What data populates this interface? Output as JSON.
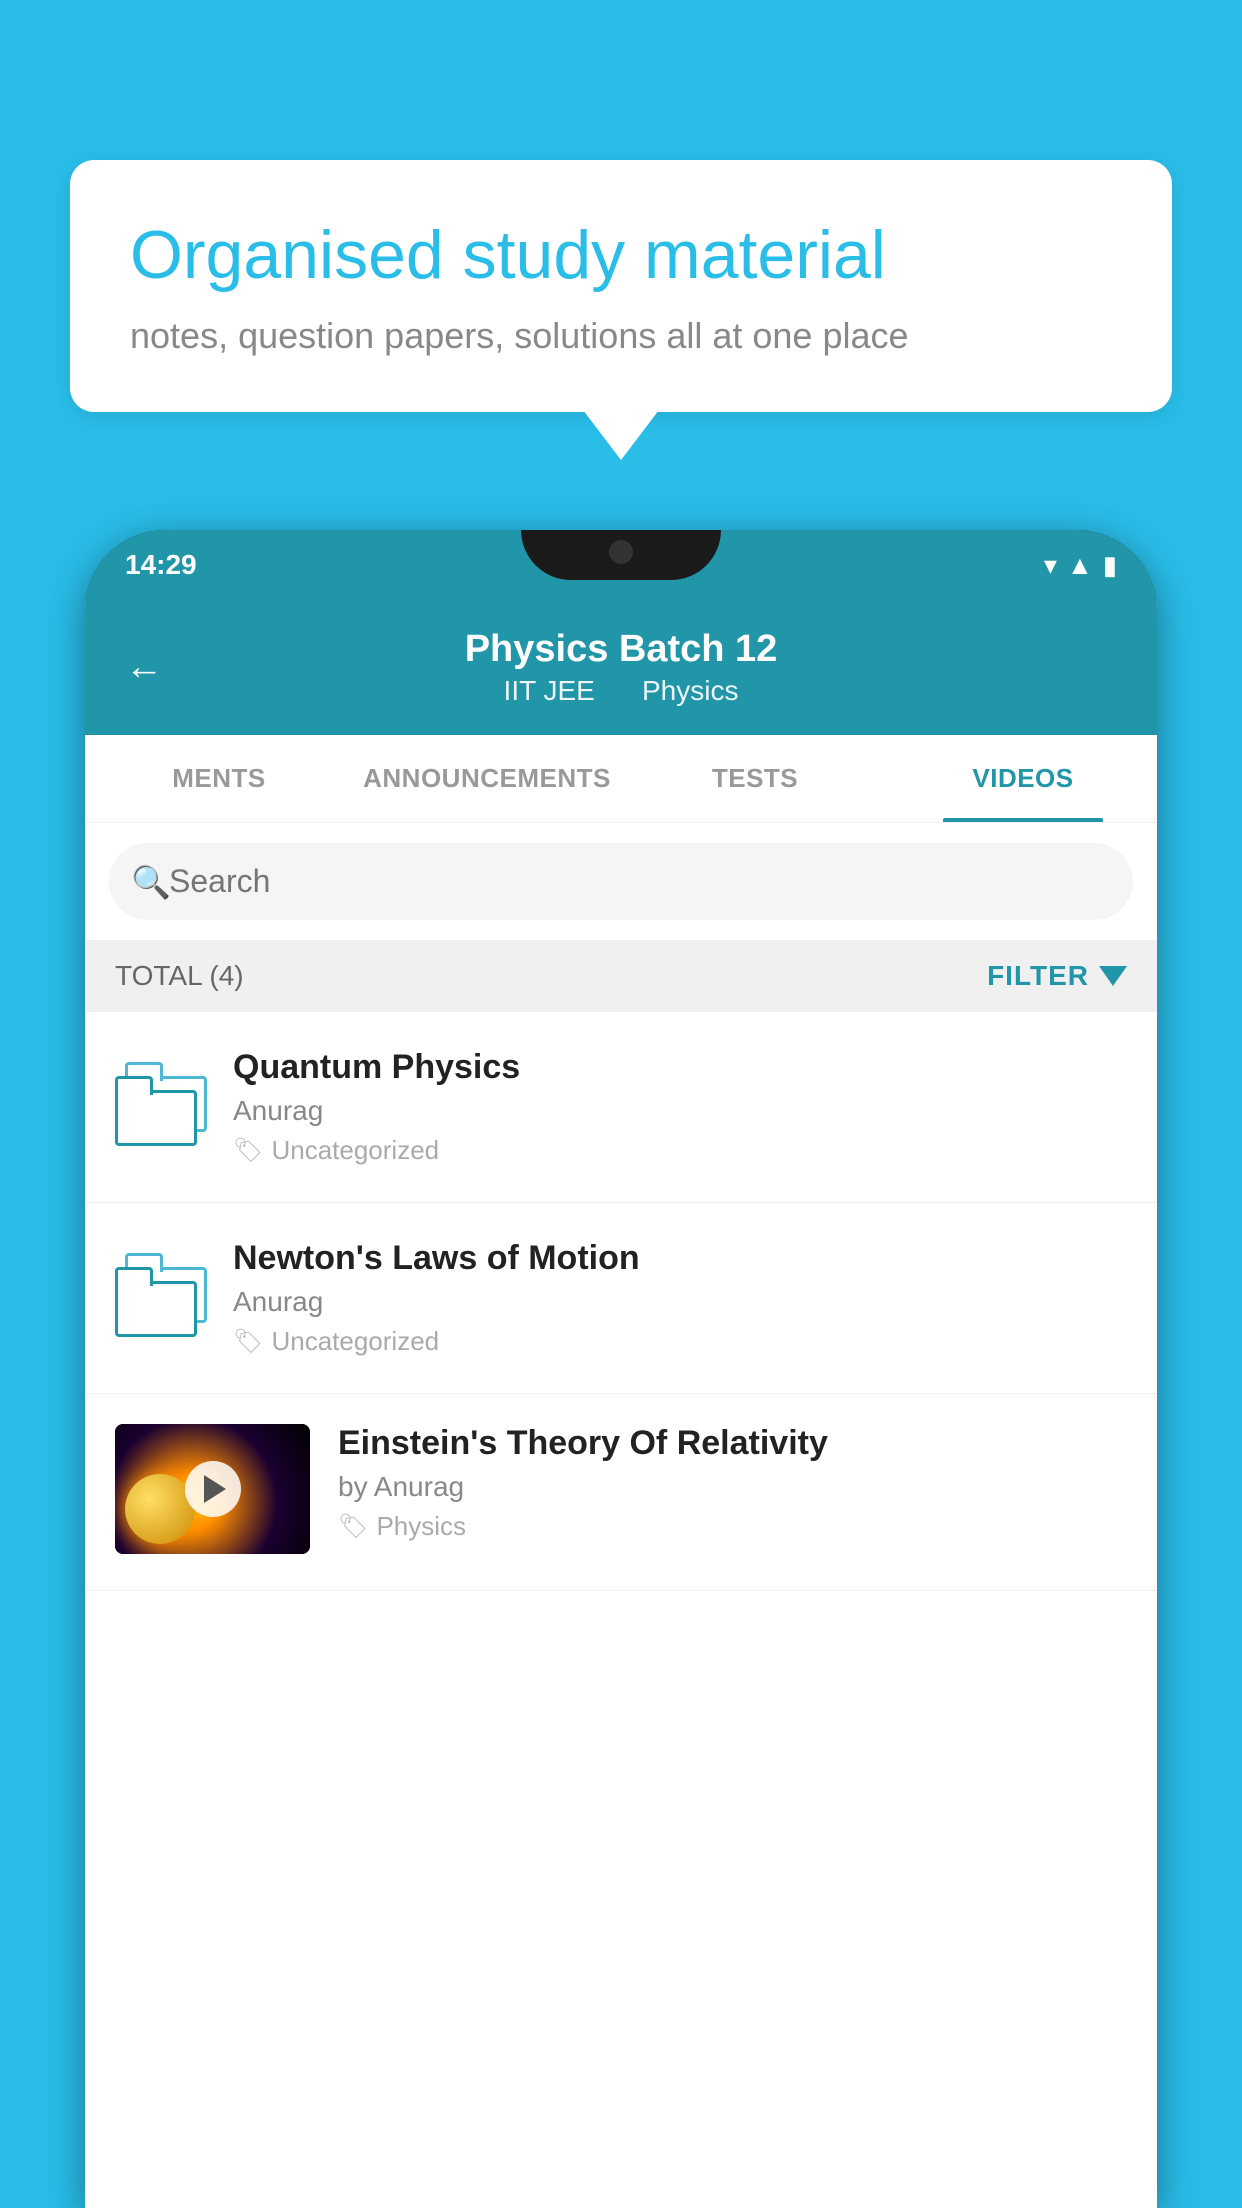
{
  "background_color": "#29bde8",
  "speech_bubble": {
    "title": "Organised study material",
    "subtitle": "notes, question papers, solutions all at one place"
  },
  "status_bar": {
    "time": "14:29",
    "icons": [
      "wifi",
      "signal",
      "battery"
    ]
  },
  "app_header": {
    "title": "Physics Batch 12",
    "subtitle_part1": "IIT JEE",
    "subtitle_part2": "Physics",
    "back_label": "←"
  },
  "tabs": [
    {
      "label": "MENTS",
      "active": false
    },
    {
      "label": "ANNOUNCEMENTS",
      "active": false
    },
    {
      "label": "TESTS",
      "active": false
    },
    {
      "label": "VIDEOS",
      "active": true
    }
  ],
  "search": {
    "placeholder": "Search"
  },
  "filter": {
    "total_label": "TOTAL (4)",
    "filter_label": "FILTER"
  },
  "videos": [
    {
      "title": "Quantum Physics",
      "author": "Anurag",
      "tag": "Uncategorized",
      "type": "folder"
    },
    {
      "title": "Newton's Laws of Motion",
      "author": "Anurag",
      "tag": "Uncategorized",
      "type": "folder"
    },
    {
      "title": "Einstein's Theory Of Relativity",
      "author": "by Anurag",
      "tag": "Physics",
      "type": "video"
    }
  ]
}
